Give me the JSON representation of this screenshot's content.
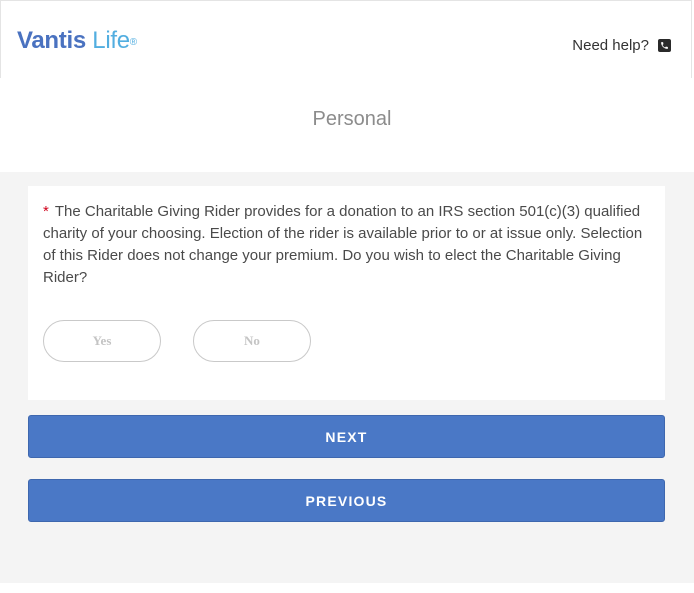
{
  "header": {
    "logo": {
      "brand_bold": "Vantis",
      "brand_light": " Life",
      "registered": "®"
    },
    "help_text": "Need help?",
    "help_icon": "phone-icon"
  },
  "section": {
    "title": "Personal"
  },
  "question": {
    "required_marker": "*",
    "text": "The Charitable Giving Rider provides for a donation to an IRS section 501(c)(3) qualified charity of your choosing. Election of the rider is available prior to or at issue only. Selection of this Rider does not change your premium. Do you wish to elect the Charitable Giving Rider?",
    "options": {
      "yes": "Yes",
      "no": "No"
    }
  },
  "navigation": {
    "next_label": "NEXT",
    "previous_label": "PREVIOUS"
  },
  "colors": {
    "primary_button": "#4a78c6",
    "brand_blue": "#4a72c0",
    "brand_light_blue": "#52aee0",
    "required_red": "#d0021b",
    "background_gray": "#f4f4f4"
  }
}
